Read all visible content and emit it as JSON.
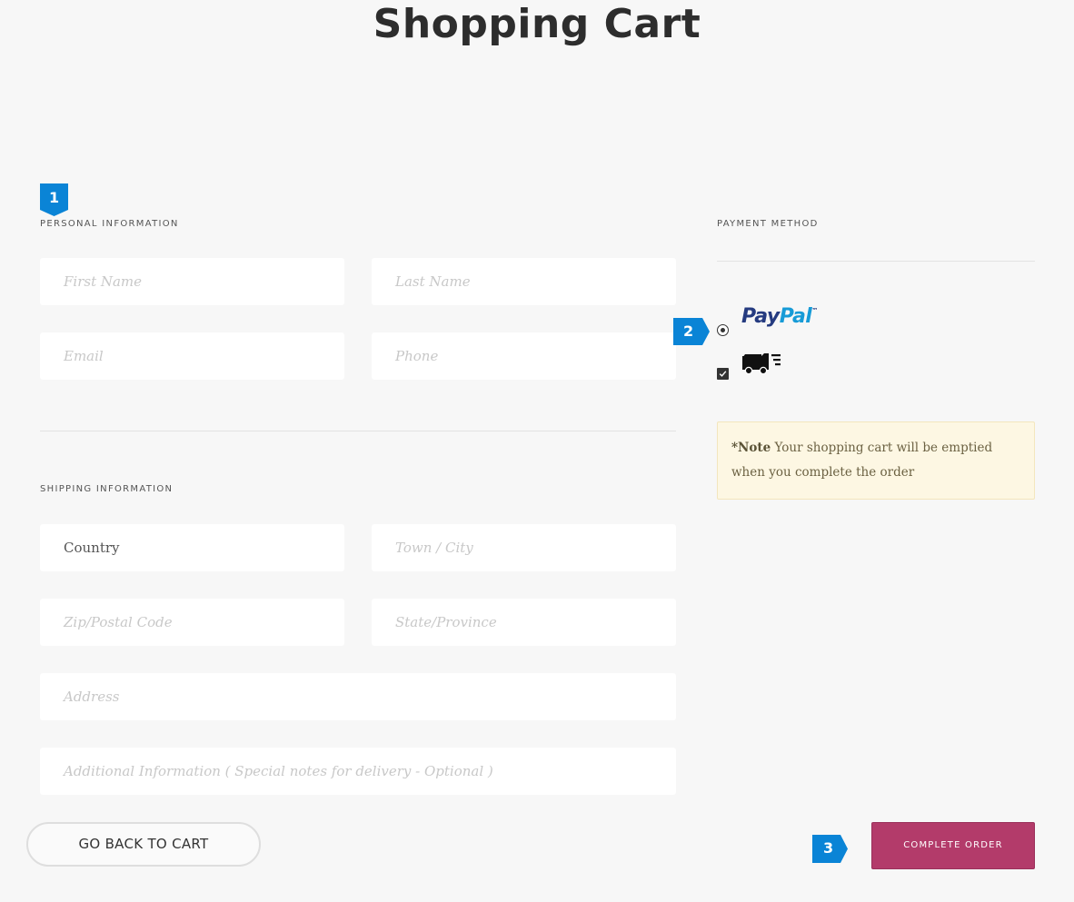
{
  "page": {
    "title": "Shopping Cart"
  },
  "personal": {
    "section_label": "PERSONAL INFORMATION",
    "step_number": "1",
    "first_name_placeholder": "First Name",
    "last_name_placeholder": "Last Name",
    "email_placeholder": "Email",
    "phone_placeholder": "Phone"
  },
  "shipping": {
    "section_label": "SHIPPING INFORMATION",
    "country_value": "Country",
    "town_placeholder": "Town / City",
    "zip_placeholder": "Zip/Postal Code",
    "state_placeholder": "State/Province",
    "address_placeholder": "Address",
    "additional_placeholder": "Additional Information ( Special notes for delivery - Optional )"
  },
  "payment": {
    "section_label": "PAYMENT METHOD",
    "step_number": "2",
    "paypal_pay": "Pay",
    "paypal_pal": "Pal",
    "paypal_tm": "™",
    "paypal_selected": true,
    "delivery_checked": true
  },
  "note": {
    "label": "*Note",
    "text": " Your shopping cart will be emptied when you complete the order"
  },
  "actions": {
    "back_label": "GO BACK TO CART",
    "complete_label": "COMPLETE ORDER",
    "step_number": "3"
  },
  "colors": {
    "badge": "#0a84d6",
    "complete_button": "#b33b6a",
    "note_bg": "#fdf7e3"
  },
  "icons": {
    "payment_paypal": "paypal-logo",
    "payment_delivery": "delivery-truck-icon"
  }
}
